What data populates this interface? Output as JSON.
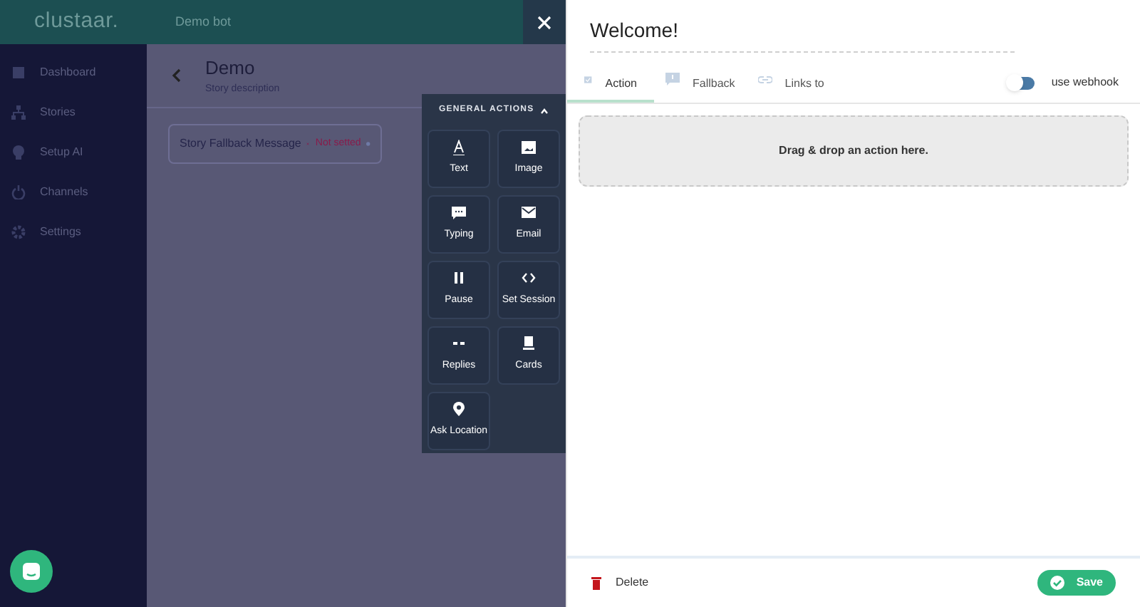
{
  "app": {
    "logo": "clustaar.",
    "bot_name": "Demo bot"
  },
  "sidebar": {
    "items": [
      {
        "label": "Dashboard"
      },
      {
        "label": "Stories"
      },
      {
        "label": "Setup AI"
      },
      {
        "label": "Channels"
      },
      {
        "label": "Settings"
      }
    ]
  },
  "story": {
    "title": "Demo",
    "description": "Story description",
    "fallback": {
      "label": "Story Fallback Message",
      "status": "Not setted"
    }
  },
  "actions_panel": {
    "title": "GENERAL ACTIONS",
    "expanded": true,
    "items": [
      {
        "label": "Text"
      },
      {
        "label": "Image"
      },
      {
        "label": "Typing"
      },
      {
        "label": "Email"
      },
      {
        "label": "Pause"
      },
      {
        "label": "Set Session"
      },
      {
        "label": "Replies"
      },
      {
        "label": "Cards"
      },
      {
        "label": "Ask Location"
      }
    ]
  },
  "editor": {
    "title": "Welcome!",
    "tabs": [
      {
        "label": "Action",
        "selected": true
      },
      {
        "label": "Fallback",
        "selected": false
      },
      {
        "label": "Links to",
        "selected": false
      }
    ],
    "webhook": {
      "label": "use webhook",
      "on": false
    },
    "dropzone": "Drag & drop an action here.",
    "delete": "Delete",
    "save": "Save"
  }
}
